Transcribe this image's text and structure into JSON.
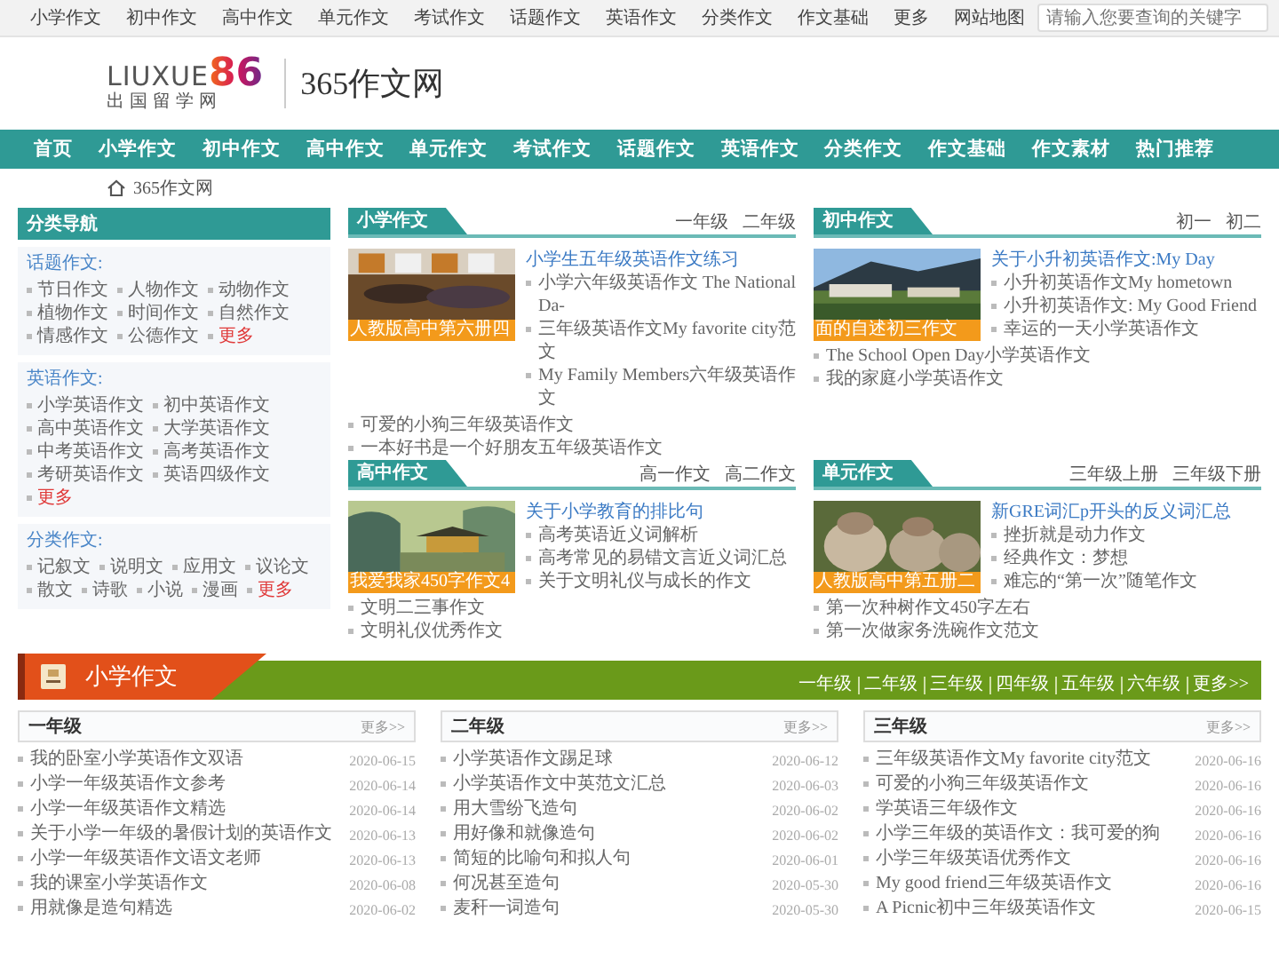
{
  "top_links": [
    "小学作文",
    "初中作文",
    "高中作文",
    "单元作文",
    "考试作文",
    "话题作文",
    "英语作文",
    "分类作文",
    "作文基础",
    "更多",
    "网站地图"
  ],
  "search": {
    "placeholder": "请输入您要查询的关键字"
  },
  "logo": {
    "wordmark": "LIUXUE",
    "number": "86",
    "tagline": "出国留学网"
  },
  "site_name": "365作文网",
  "nav": [
    "首页",
    "小学作文",
    "初中作文",
    "高中作文",
    "单元作文",
    "考试作文",
    "话题作文",
    "英语作文",
    "分类作文",
    "作文基础",
    "作文素材",
    "热门推荐"
  ],
  "breadcrumb": "365作文网",
  "sidebar": {
    "title": "分类导航",
    "groups": [
      {
        "title": "话题作文:",
        "items": [
          "节日作文",
          "人物作文",
          "动物作文",
          "植物作文",
          "时间作文",
          "自然作文",
          "情感作文",
          "公德作文"
        ],
        "more": "更多"
      },
      {
        "title": "英语作文:",
        "items": [
          "小学英语作文",
          "初中英语作文",
          "高中英语作文",
          "大学英语作文",
          "中考英语作文",
          "高考英语作文",
          "考研英语作文",
          "英语四级作文"
        ],
        "more": "更多"
      },
      {
        "title": "分类作文:",
        "items": [
          "记叙文",
          "说明文",
          "应用文",
          "议论文",
          "散文",
          "诗歌",
          "小说",
          "漫画"
        ],
        "more": "更多"
      }
    ]
  },
  "panels": [
    {
      "title": "小学作文",
      "tabs": [
        "一年级",
        "二年级"
      ],
      "caption": "人教版高中第六册四",
      "headline": "小学生五年级英语作文练习",
      "items": [
        "小学六年级英语作文 The National Da-",
        "三年级英语作文My favorite city范文",
        "My Family Members六年级英语作文"
      ],
      "more_items": [
        "可爱的小狗三年级英语作文",
        "一本好书是一个好朋友五年级英语作文"
      ]
    },
    {
      "title": "初中作文",
      "tabs": [
        "初一",
        "初二"
      ],
      "caption": "面的自述初三作文",
      "headline": "关于小升初英语作文:My Day",
      "items": [
        "小升初英语作文My hometown",
        "小升初英语作文: My Good Friend",
        "幸运的一天小学英语作文"
      ],
      "more_items": [
        "The School Open Day小学英语作文",
        "我的家庭小学英语作文"
      ]
    },
    {
      "title": "高中作文",
      "tabs": [
        "高一作文",
        "高二作文"
      ],
      "caption": "我爱我家450字作文4",
      "headline": "关于小学教育的排比句",
      "items": [
        "高考英语近义词解析",
        "高考常见的易错文言近义词汇总",
        "关于文明礼仪与成长的作文"
      ],
      "more_items": [
        "文明二三事作文",
        "文明礼仪优秀作文"
      ]
    },
    {
      "title": "单元作文",
      "tabs": [
        "三年级上册",
        "三年级下册"
      ],
      "caption": "人教版高中第五册二",
      "headline": "新GRE词汇p开头的反义词汇总",
      "items": [
        "挫折就是动力作文",
        "经典作文：梦想",
        "难忘的“第一次”随笔作文"
      ],
      "more_items": [
        "第一次种树作文450字左右",
        "第一次做家务洗碗作文范文"
      ]
    }
  ],
  "section": {
    "title": "小学作文",
    "grade_links": [
      "一年级",
      "二年级",
      "三年级",
      "四年级",
      "五年级",
      "六年级",
      "更多>>"
    ],
    "columns": [
      {
        "title": "一年级",
        "more": "更多>>",
        "rows": [
          {
            "title": "我的卧室小学英语作文双语",
            "date": "2020-06-15"
          },
          {
            "title": "小学一年级英语作文参考",
            "date": "2020-06-14"
          },
          {
            "title": "小学一年级英语作文精选",
            "date": "2020-06-14"
          },
          {
            "title": "关于小学一年级的暑假计划的英语作文",
            "date": "2020-06-13"
          },
          {
            "title": "小学一年级英语作文语文老师",
            "date": "2020-06-13"
          },
          {
            "title": "我的课室小学英语作文",
            "date": "2020-06-08"
          },
          {
            "title": "用就像是造句精选",
            "date": "2020-06-02"
          }
        ]
      },
      {
        "title": "二年级",
        "more": "更多>>",
        "rows": [
          {
            "title": "小学英语作文踢足球",
            "date": "2020-06-12"
          },
          {
            "title": "小学英语作文中英范文汇总",
            "date": "2020-06-03"
          },
          {
            "title": "用大雪纷飞造句",
            "date": "2020-06-02"
          },
          {
            "title": "用好像和就像造句",
            "date": "2020-06-02"
          },
          {
            "title": "简短的比喻句和拟人句",
            "date": "2020-06-01"
          },
          {
            "title": "何况甚至造句",
            "date": "2020-05-30"
          },
          {
            "title": "麦秆一词造句",
            "date": "2020-05-30"
          }
        ]
      },
      {
        "title": "三年级",
        "more": "更多>>",
        "rows": [
          {
            "title": "三年级英语作文My favorite city范文",
            "date": "2020-06-16"
          },
          {
            "title": "可爱的小狗三年级英语作文",
            "date": "2020-06-16"
          },
          {
            "title": "学英语三年级作文",
            "date": "2020-06-16"
          },
          {
            "title": "小学三年级的英语作文：我可爱的狗",
            "date": "2020-06-16"
          },
          {
            "title": "小学三年级英语优秀作文",
            "date": "2020-06-16"
          },
          {
            "title": "My good friend三年级英语作文",
            "date": "2020-06-16"
          },
          {
            "title": "A Picnic初中三年级英语作文",
            "date": "2020-06-15"
          }
        ]
      }
    ]
  }
}
